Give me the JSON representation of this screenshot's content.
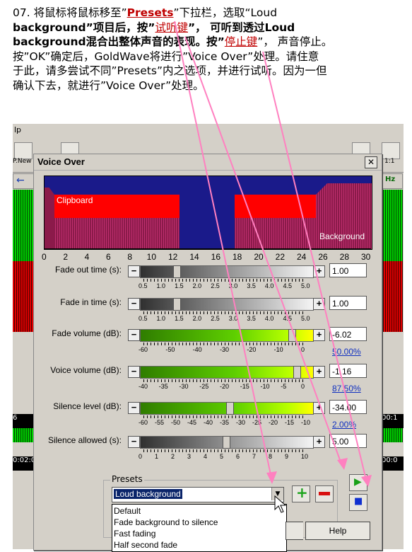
{
  "instruction": {
    "line1_pre": "07. 将鼠标将鼠标移至”",
    "line1_link": "Presets",
    "line1_post": "”下拉栏，选取“Loud",
    "line2_pre": "background”项目后，按”",
    "line2_link": "试听键",
    "line2_post": "”， 可听到透过Loud",
    "line3_pre": "background混合出整体声音的表现。按”",
    "line3_link": "停止键",
    "line3_post": "”， 声音停止。",
    "line4": "按”OK”确定后，GoldWave将进行”Voice Over”处理。请住意",
    "line5": "于此，请多尝试不同”Presets”内之选项，并进行试听。因为一但",
    "line6": "确认下去，就进行”Voice Over”处理。"
  },
  "background_app": {
    "menu_fragment": "lp",
    "toolbar_label_new": "P.New",
    "toolbar_label_1to1": "1:1",
    "hz_label": "Hz",
    "time_left_1": "6",
    "time_left_2": "0:02:0",
    "time_right_1": "00:1",
    "time_right_2": "00:0"
  },
  "dialog": {
    "title": "Voice Over",
    "close_glyph": "✕",
    "graph": {
      "clipboard_label": "Clipboard",
      "background_label": "Background",
      "axis_ticks": [
        "0",
        "2",
        "4",
        "6",
        "8",
        "10",
        "12",
        "14",
        "16",
        "18",
        "20",
        "22",
        "24",
        "26",
        "28",
        "30"
      ]
    },
    "rows": [
      {
        "label": "Fade out time (s):",
        "value": "1.00",
        "scale": [
          "0.5",
          "1.0",
          "1.5",
          "2.0",
          "2.5",
          "3.0",
          "3.5",
          "4.0",
          "4.5",
          "5.0"
        ],
        "level": 0.2,
        "pct": ""
      },
      {
        "label": "Fade in time (s):",
        "value": "1.00",
        "scale": [
          "0.5",
          "1.0",
          "1.5",
          "2.0",
          "2.5",
          "3.0",
          "3.5",
          "4.0",
          "4.5",
          "5.0"
        ],
        "level": 0.2,
        "pct": ""
      },
      {
        "label": "Fade volume (dB):",
        "value": "-6.02",
        "scale": [
          "-60",
          "-50",
          "-40",
          "-30",
          "-20",
          "-10",
          "0"
        ],
        "level": 0.9,
        "pct": "50.00%"
      },
      {
        "label": "Voice volume (dB):",
        "value": "-1.16",
        "scale": [
          "-40",
          "-35",
          "-30",
          "-25",
          "-20",
          "-15",
          "-10",
          "-5",
          "0"
        ],
        "level": 0.93,
        "pct": "87.50%"
      },
      {
        "label": "Silence level (dB):",
        "value": "-34.00",
        "scale": [
          "-60",
          "-55",
          "-50",
          "-45",
          "-40",
          "-35",
          "-30",
          "-25",
          "-20",
          "-15",
          "-10"
        ],
        "level": 0.52,
        "pct": "2.00%"
      },
      {
        "label": "Silence allowed (s):",
        "value": "5.00",
        "scale": [
          "0",
          "1",
          "2",
          "3",
          "4",
          "5",
          "6",
          "7",
          "8",
          "9",
          "10"
        ],
        "level": 0.5,
        "pct": ""
      }
    ],
    "presets": {
      "group_label": "Presets",
      "selected": "Loud background",
      "options": [
        "Default",
        "Fade background to silence",
        "Fast fading",
        "Half second fade"
      ]
    },
    "play_glyph": "▶",
    "stop_glyph": "■",
    "add_glyph": "+",
    "remove_glyph": "−",
    "help_label": "Help"
  },
  "colors": {
    "accent_red": "#ff0000",
    "graph_blue": "#1a1a8a",
    "arrow_pink": "#ff80c0",
    "link_red": "#c00000"
  }
}
